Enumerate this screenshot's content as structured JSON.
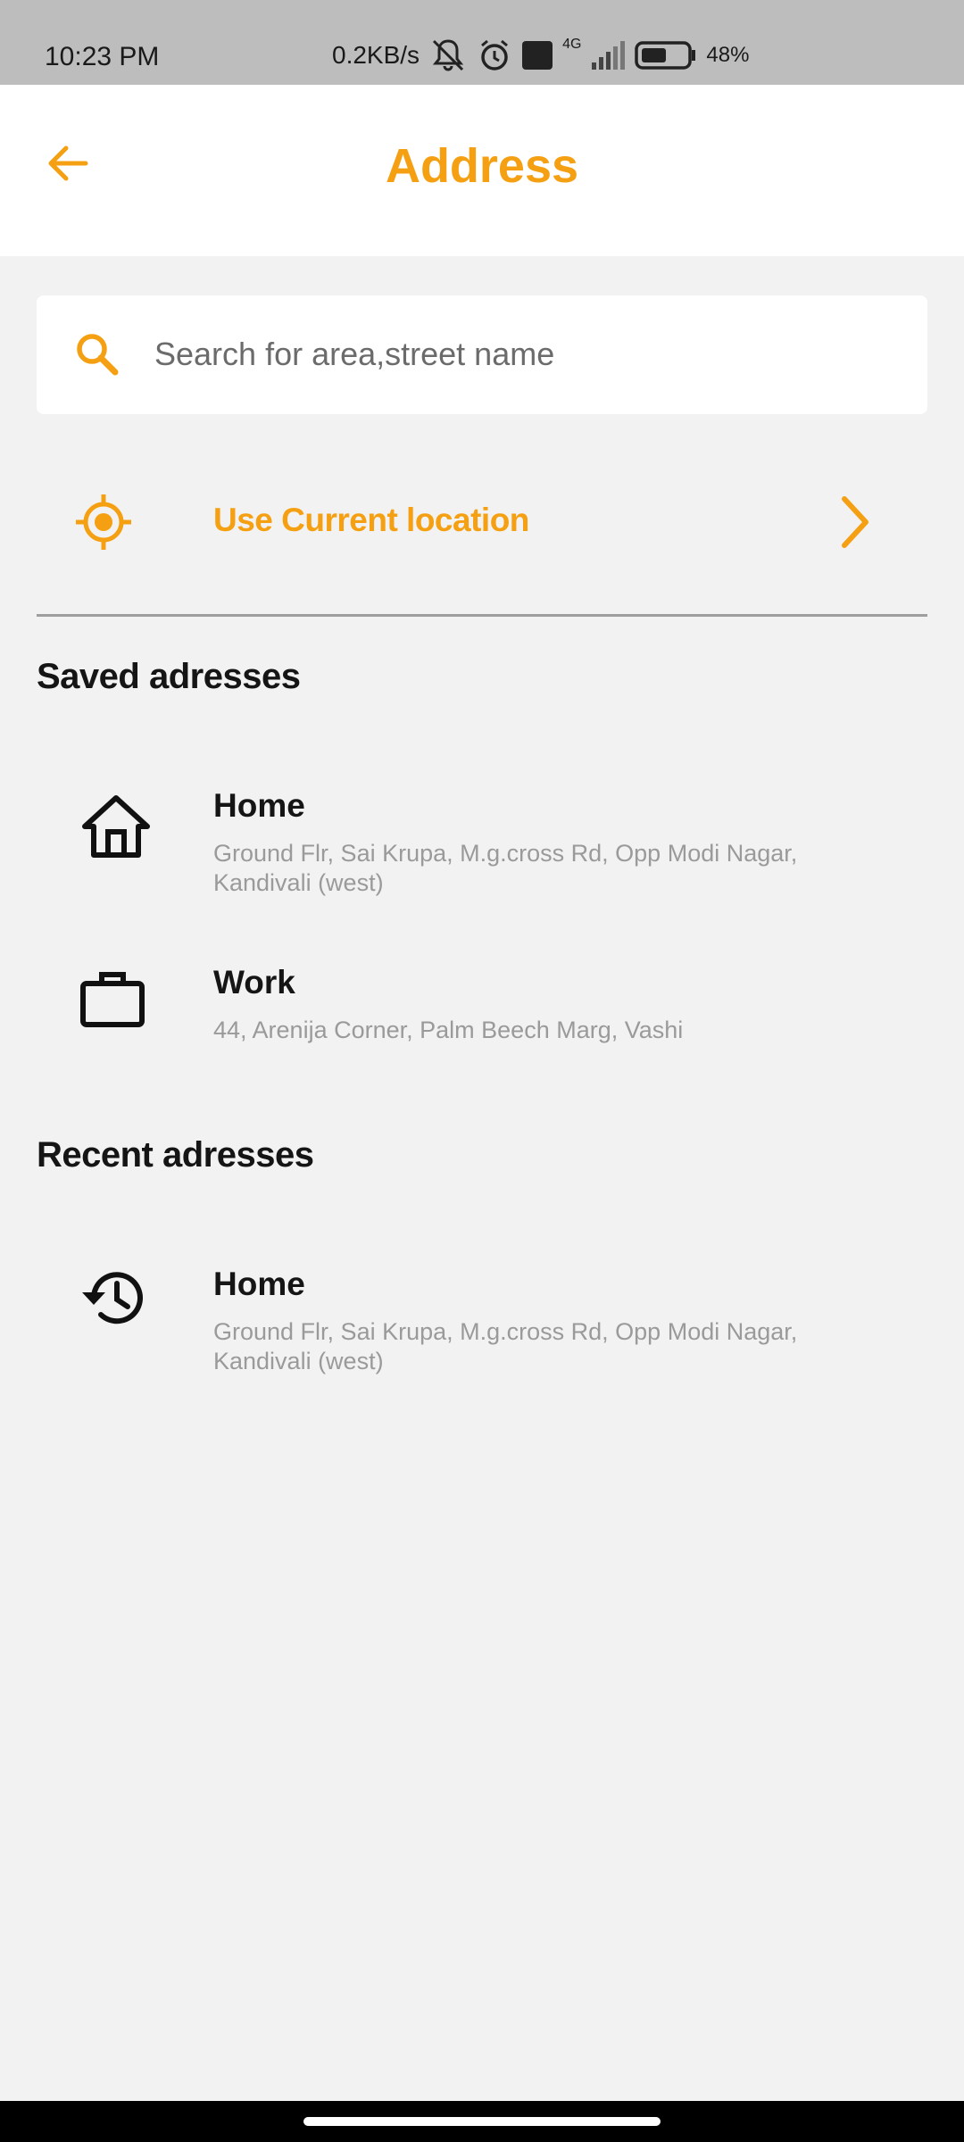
{
  "status_bar": {
    "time": "10:23 PM",
    "network_speed": "0.2KB/s",
    "network_type": "4G",
    "volte_label": "Vo LTE",
    "battery": "48%",
    "icons": [
      "mute-icon",
      "alarm-icon",
      "volte-icon",
      "signal-icon",
      "battery-icon"
    ]
  },
  "header": {
    "title": "Address",
    "back_icon": "arrow-left-icon"
  },
  "search": {
    "placeholder": "Search for area,street name",
    "value": "",
    "icon": "search-icon"
  },
  "current_location": {
    "label": "Use Current location",
    "icon": "crosshair-icon",
    "chevron": "chevron-right-icon"
  },
  "saved": {
    "title": "Saved adresses",
    "items": [
      {
        "name": "Home",
        "detail": "Ground Flr, Sai Krupa, M.g.cross Rd, Opp Modi Nagar, Kandivali (west)",
        "icon": "home-icon"
      },
      {
        "name": "Work",
        "detail": " 44, Arenija Corner, Palm Beech Marg, Vashi",
        "icon": "briefcase-icon"
      }
    ]
  },
  "recent": {
    "title": "Recent adresses",
    "items": [
      {
        "name": "Home",
        "detail": "Ground Flr, Sai Krupa, M.g.cross Rd, Opp Modi Nagar, Kandivali (west)",
        "icon": "history-icon"
      }
    ]
  },
  "colors": {
    "accent": "#f5a013",
    "background": "#f2f2f2",
    "status_bar": "#bdbdbd",
    "text_primary": "#151515",
    "text_secondary": "#9a9a9a"
  }
}
